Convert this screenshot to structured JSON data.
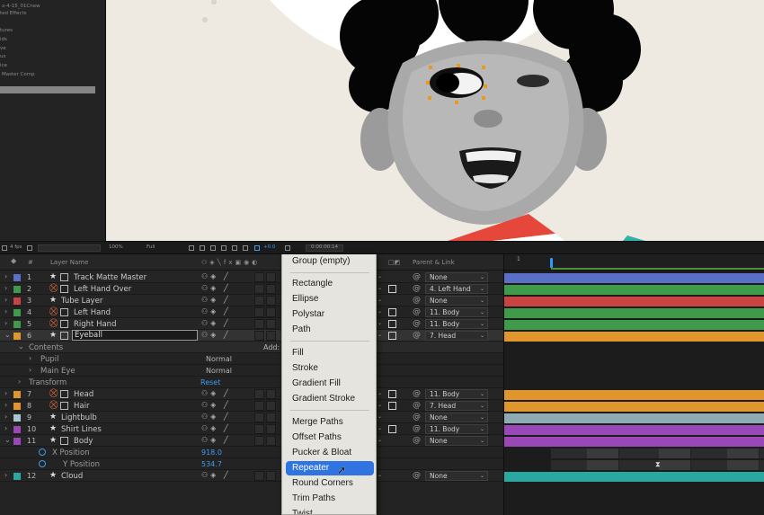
{
  "project_panel": {
    "items": [
      "x-4-15_01Cnew",
      "ted Effects",
      "tures",
      "ids",
      "ve",
      "us",
      "ice",
      "Master Comp"
    ]
  },
  "viewer_toolbar": {
    "fps": "4 fps",
    "zoom": "100%",
    "resolution": "Full",
    "exposure": "+0.0",
    "timecode": "0:00:00:14"
  },
  "layer_header": {
    "hash": "#",
    "layer_name": "Layer Name",
    "parent_link": "Parent & Link"
  },
  "layers": [
    {
      "num": "1",
      "name": "Track Matte Master",
      "color": "#5a70c7",
      "parent": "None",
      "icon": "star-icon"
    },
    {
      "num": "2",
      "name": "Left Hand Over",
      "color": "#3f9a4a",
      "parent": "4. Left Hand",
      "icon": "star-icon"
    },
    {
      "num": "3",
      "name": "Tube Layer",
      "color": "#c94343",
      "parent": "None",
      "icon": "star-icon"
    },
    {
      "num": "4",
      "name": "Left Hand",
      "color": "#3f9a4a",
      "parent": "11. Body",
      "icon": "star-icon"
    },
    {
      "num": "5",
      "name": "Right Hand",
      "color": "#3f9a4a",
      "parent": "11. Body",
      "icon": "star-icon"
    },
    {
      "num": "6",
      "name": "Eyeball",
      "color": "#e0962d",
      "parent": "7. Head",
      "icon": "star-icon"
    },
    {
      "num": "7",
      "name": "Head",
      "color": "#e0962d",
      "parent": "11. Body",
      "icon": "star-icon"
    },
    {
      "num": "8",
      "name": "Hair",
      "color": "#e0962d",
      "parent": "7. Head",
      "icon": "star-icon"
    },
    {
      "num": "9",
      "name": "Lightbulb",
      "color": "#a8c8d2",
      "parent": "None",
      "icon": "star-icon"
    },
    {
      "num": "10",
      "name": "Shirt Lines",
      "color": "#9a47b8",
      "parent": "11. Body",
      "icon": "star-icon"
    },
    {
      "num": "11",
      "name": "Body",
      "color": "#9a47b8",
      "parent": "None",
      "icon": "star-icon"
    },
    {
      "num": "12",
      "name": "Cloud",
      "color": "#2aa7a0",
      "parent": "None",
      "icon": "star-icon"
    }
  ],
  "eyeball_props": {
    "contents": "Contents",
    "add": "Add:",
    "pupil": "Pupil",
    "pupil_mode": "Normal",
    "main_eye": "Main Eye",
    "main_eye_mode": "Normal",
    "transform": "Transform",
    "reset": "Reset"
  },
  "body_props": {
    "x_position_label": "X Position",
    "x_position_value": "918.0",
    "y_position_label": "Y Position",
    "y_position_value": "534.7"
  },
  "context_menu": {
    "group_1": [
      "Group (empty)"
    ],
    "group_2": [
      "Rectangle",
      "Ellipse",
      "Polystar",
      "Path"
    ],
    "group_3": [
      "Fill",
      "Stroke",
      "Gradient Fill",
      "Gradient Stroke"
    ],
    "group_4": [
      "Merge Paths",
      "Offset Paths",
      "Pucker & Bloat",
      "Repeater",
      "Round Corners",
      "Trim Paths",
      "Twist"
    ],
    "selected": "Repeater"
  },
  "timeline": {
    "marker": "1"
  },
  "colors": {
    "accent_blue": "#2f74e0",
    "value_blue": "#3e9bf0",
    "comp_bg": "#eeeae1"
  }
}
